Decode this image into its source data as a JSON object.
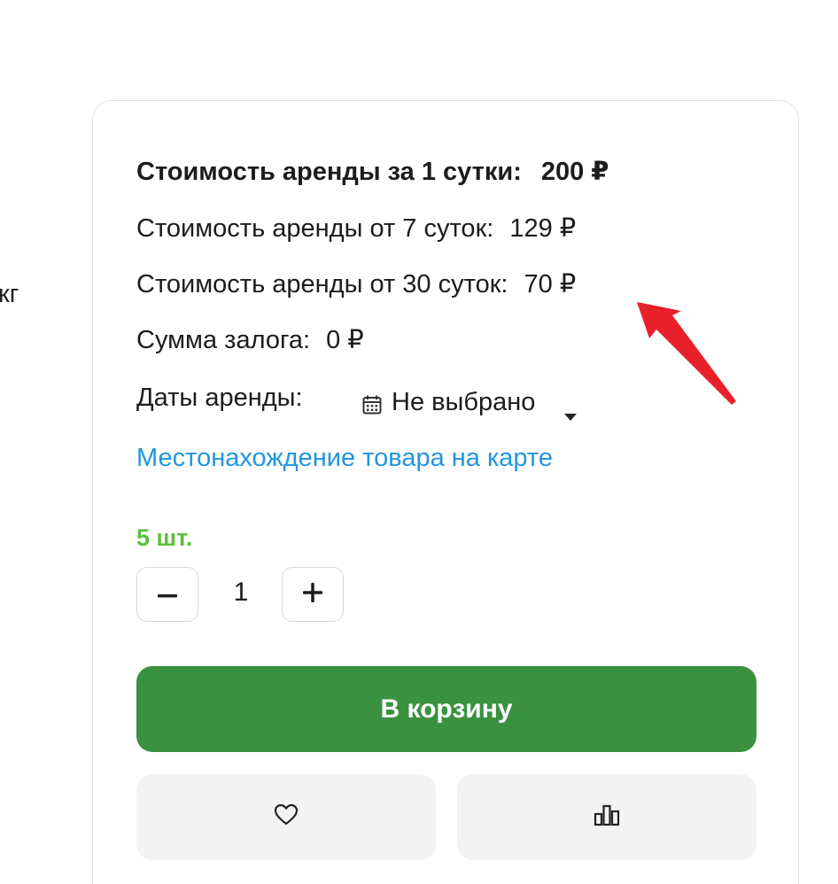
{
  "left_fragment": "кг",
  "pricing": {
    "daily": {
      "label": "Стоимость аренды за 1 сутки:",
      "value": "200 ₽"
    },
    "week": {
      "label": "Стоимость аренды от 7 суток:",
      "value": "129 ₽"
    },
    "month": {
      "label": "Стоимость аренды от 30 суток:",
      "value": "70 ₽"
    },
    "deposit": {
      "label": "Сумма залога:",
      "value": "0 ₽"
    }
  },
  "dates": {
    "label": "Даты аренды:",
    "selected": "Не выбрано",
    "icon": "calendar-icon"
  },
  "map_link": "Местонахождение товара на карте",
  "stock": "5 шт.",
  "quantity": {
    "minus_label": "−",
    "value": "1",
    "plus_label": "+"
  },
  "cart_button": "В корзину",
  "secondary_buttons": {
    "favorite_icon": "heart-icon",
    "compare_icon": "bar-chart-icon"
  },
  "colors": {
    "accent_green": "#3a9140",
    "stock_green": "#5cbf3c",
    "link_blue": "#2196e0",
    "annotation_red": "#e8202a"
  }
}
